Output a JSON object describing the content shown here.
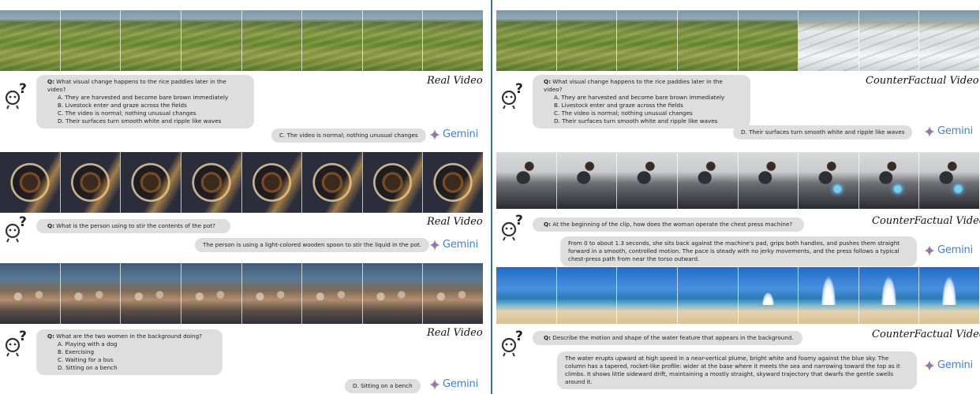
{
  "gemini_label": "Gemini",
  "q_prefix": "Q:",
  "colors": {
    "gemini_blue": "#3c7ee8",
    "bubble_gray": "#dedede",
    "divider": "#3d6f8f"
  },
  "left": {
    "panels": [
      {
        "video_label": "Real Video",
        "question": "What visual change happens to the rice paddies later in the video?",
        "options": [
          "A. They are harvested and become bare brown immediately",
          "B. Livestock enter and graze across the fields",
          "C. The video is normal; nothing unusual changes",
          "D. Their surfaces turn smooth white and ripple like waves"
        ],
        "answer": "C. The video is normal; nothing unusual changes"
      },
      {
        "video_label": "Real Video",
        "question": "What is the person using to stir the contents of the pot?",
        "answer": "The person is using a light-colored wooden spoon to stir the liquid in the pot."
      },
      {
        "video_label": "Real Video",
        "question": "What are the two women in the background doing?",
        "options": [
          "A. Playing with a dog",
          "B. Exercising",
          "C. Waiting for a bus",
          "D. Sitting on a bench"
        ],
        "answer": "D. Sitting on a bench"
      }
    ]
  },
  "right": {
    "panels": [
      {
        "video_label": "CounterFactual Video",
        "question": "What visual change happens to the rice paddies later in the video?",
        "options": [
          "A. They are harvested and become bare brown immediately",
          "B. Livestock enter and graze across the fields",
          "C. The video is normal; nothing unusual changes",
          "D. Their surfaces turn smooth white and ripple like waves"
        ],
        "answer": "D. Their surfaces turn smooth white and ripple like waves"
      },
      {
        "video_label": "CounterFactual Video",
        "question": "At the beginning of the clip, how does the woman operate the chest press machine?",
        "answer": "From 0 to about 1.3 seconds, she sits back against the machine's pad, grips both handles, and pushes them straight forward in a smooth, controlled motion. The pace is steady with no jerky movements, and the press follows a typical chest-press path from near the torso outward."
      },
      {
        "video_label": "CounterFactual Video",
        "question": "Describe the motion and shape of the water feature that appears in the background.",
        "answer": "The water erupts upward at high speed in a near-vertical plume, bright white and foamy against the blue sky. The column has a tapered, rocket-like profile: wider at the base where it meets the sea and narrowing toward the top as it climbs. It shows little sideward drift, maintaining a mostly straight, skyward trajectory that dwarfs the gentle swells around it."
      }
    ]
  }
}
